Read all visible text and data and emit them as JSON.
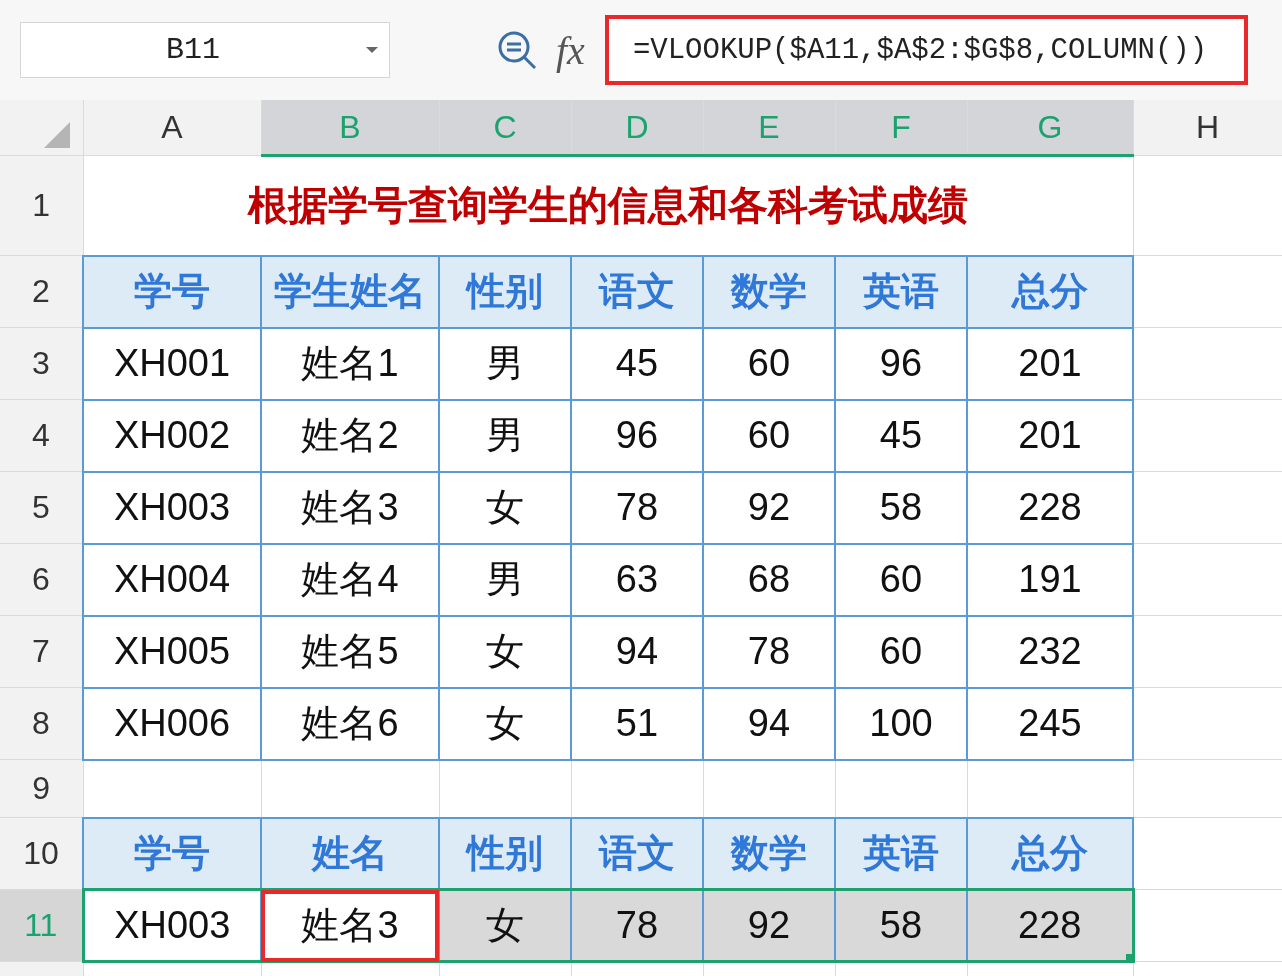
{
  "name_box": {
    "value": "B11"
  },
  "formula_bar": {
    "function_label": "fx",
    "formula": "=VLOOKUP($A11,$A$2:$G$8,COLUMN())",
    "highlighted": true
  },
  "columns": [
    {
      "label": "A",
      "selected": false
    },
    {
      "label": "B",
      "selected": true
    },
    {
      "label": "C",
      "selected": true
    },
    {
      "label": "D",
      "selected": true
    },
    {
      "label": "E",
      "selected": true
    },
    {
      "label": "F",
      "selected": true
    },
    {
      "label": "G",
      "selected": true
    },
    {
      "label": "H",
      "selected": false
    }
  ],
  "rows": [
    {
      "number": "1",
      "kind": "title",
      "selected": false,
      "cells": [
        "根据学号查询学生的信息和各科考试成绩"
      ]
    },
    {
      "number": "2",
      "kind": "header",
      "selected": false,
      "cells": [
        "学号",
        "学生姓名",
        "性别",
        "语文",
        "数学",
        "英语",
        "总分"
      ]
    },
    {
      "number": "3",
      "kind": "data",
      "selected": false,
      "cells": [
        "XH001",
        "姓名1",
        "男",
        "45",
        "60",
        "96",
        "201"
      ]
    },
    {
      "number": "4",
      "kind": "data",
      "selected": false,
      "cells": [
        "XH002",
        "姓名2",
        "男",
        "96",
        "60",
        "45",
        "201"
      ]
    },
    {
      "number": "5",
      "kind": "data",
      "selected": false,
      "cells": [
        "XH003",
        "姓名3",
        "女",
        "78",
        "92",
        "58",
        "228"
      ]
    },
    {
      "number": "6",
      "kind": "data",
      "selected": false,
      "cells": [
        "XH004",
        "姓名4",
        "男",
        "63",
        "68",
        "60",
        "191"
      ]
    },
    {
      "number": "7",
      "kind": "data",
      "selected": false,
      "cells": [
        "XH005",
        "姓名5",
        "女",
        "94",
        "78",
        "60",
        "232"
      ]
    },
    {
      "number": "8",
      "kind": "data",
      "selected": false,
      "cells": [
        "XH006",
        "姓名6",
        "女",
        "51",
        "94",
        "100",
        "245"
      ]
    },
    {
      "number": "9",
      "kind": "empty",
      "selected": false
    },
    {
      "number": "10",
      "kind": "header",
      "selected": false,
      "cells": [
        "学号",
        "姓名",
        "性别",
        "语文",
        "数学",
        "英语",
        "总分"
      ]
    },
    {
      "number": "11",
      "kind": "result",
      "selected": true,
      "cells": [
        {
          "text": "XH003",
          "selected": false,
          "outlined": false
        },
        {
          "text": "姓名3",
          "selected": false,
          "outlined": true
        },
        {
          "text": "女",
          "selected": true,
          "outlined": false
        },
        {
          "text": "78",
          "selected": true,
          "outlined": false
        },
        {
          "text": "92",
          "selected": true,
          "outlined": false
        },
        {
          "text": "58",
          "selected": true,
          "outlined": false
        },
        {
          "text": "228",
          "selected": true,
          "outlined": false
        }
      ]
    }
  ]
}
